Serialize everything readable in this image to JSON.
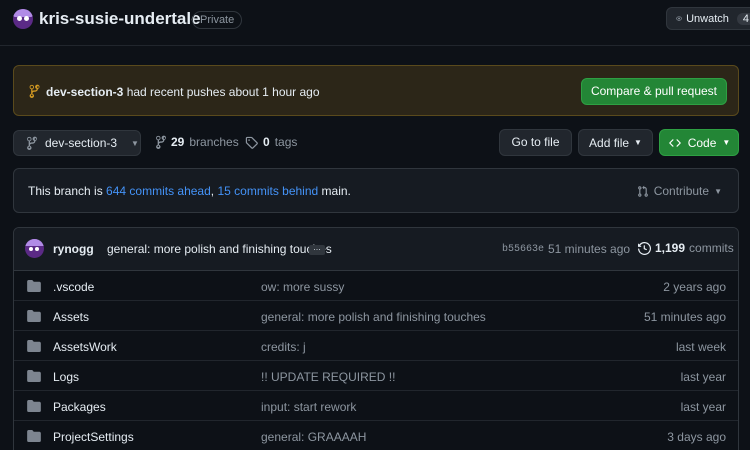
{
  "repo": {
    "name": "kris-susie-undertale",
    "visibility": "Private",
    "unwatch_label": "Unwatch",
    "watch_count": "4"
  },
  "banner": {
    "branch": "dev-section-3",
    "message": "had recent pushes about 1 hour ago",
    "compare_label": "Compare & pull request"
  },
  "toolbar": {
    "branch_select": "dev-section-3",
    "branches_count": "29",
    "branches_label": "branches",
    "tags_count": "0",
    "tags_label": "tags",
    "goto_label": "Go to file",
    "addfile_label": "Add file",
    "code_label": "Code"
  },
  "compare": {
    "prefix": "This branch is",
    "ahead": "644 commits ahead",
    "separator": ",",
    "behind": "15 commits behind",
    "suffix": "main.",
    "contribute_label": "Contribute"
  },
  "latest_commit": {
    "author": "rynogg",
    "message": "general: more polish and finishing touches",
    "ellipsis": "…",
    "sha": "b55663e",
    "time": "51 minutes ago",
    "count": "1,199",
    "count_label": "commits"
  },
  "files": [
    {
      "name": ".vscode",
      "message": "ow: more sussy",
      "age": "2 years ago"
    },
    {
      "name": "Assets",
      "message": "general: more polish and finishing touches",
      "age": "51 minutes ago"
    },
    {
      "name": "AssetsWork",
      "message": "credits: j",
      "age": "last week"
    },
    {
      "name": "Logs",
      "message": "!! UPDATE REQUIRED !!",
      "age": "last year"
    },
    {
      "name": "Packages",
      "message": "input: start rework",
      "age": "last year"
    },
    {
      "name": "ProjectSettings",
      "message": "general: GRAAAAH",
      "age": "3 days ago"
    }
  ],
  "colors": {
    "background": "#0d1117",
    "accent_green": "#238636",
    "link_blue": "#4493f8",
    "banner_bg": "#2c2618",
    "folder": "#7d8590"
  }
}
